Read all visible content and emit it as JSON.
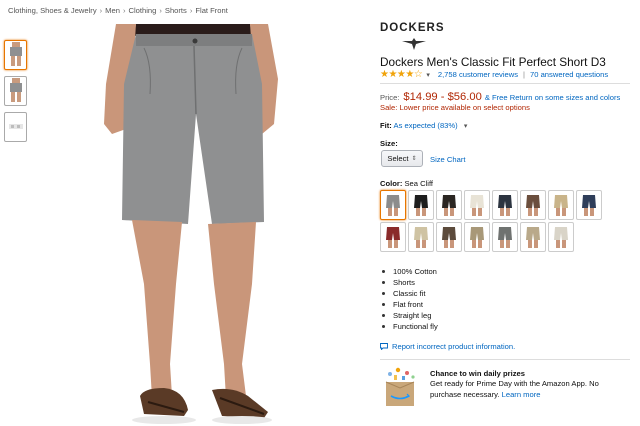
{
  "breadcrumb": [
    "Clothing, Shoes & Jewelry",
    "Men",
    "Clothing",
    "Shorts",
    "Flat Front"
  ],
  "breadcrumb_separator": "›",
  "brand": {
    "name": "DOCKERS"
  },
  "product": {
    "title": "Dockers Men's Classic Fit Perfect Short D3",
    "stars_glyph": "★★★★☆",
    "rating_caret": "▾",
    "reviews": "2,758 customer reviews",
    "divider": "|",
    "questions": "70 answered questions"
  },
  "price": {
    "label": "Price:",
    "value": "$14.99 - $56.00",
    "shipping_text": "& Free Return on some sizes and colors",
    "sale_label": "Sale:",
    "sale_text": "Lower price available on select options"
  },
  "fit": {
    "label": "Fit:",
    "value": "As expected (83%)",
    "caret": "▾"
  },
  "size": {
    "label": "Size:",
    "select_value": "Select",
    "select_arrow": "⇕",
    "chart_link": "Size Chart"
  },
  "color": {
    "label": "Color:",
    "selected": "Sea Cliff",
    "swatches": [
      "#8c8c8c",
      "#1e1e1e",
      "#2b2622",
      "#e8e3d6",
      "#2c3440",
      "#6b4e3d",
      "#c9b48a",
      "#2f3e5a",
      "#8a2a2a",
      "#cfc3a3",
      "#5c4b3c",
      "#a89878",
      "#6f7270",
      "#b9a98a",
      "#d9d4c8"
    ]
  },
  "bullets": [
    "100% Cotton",
    "Shorts",
    "Classic fit",
    "Flat front",
    "Straight leg",
    "Functional fly"
  ],
  "report": {
    "text": "Report incorrect product information."
  },
  "promo": {
    "title": "Chance to win daily prizes",
    "text": "Get ready for Prime Day with the Amazon App. No purchase necessary.",
    "link": "Learn more"
  },
  "colors": {
    "link": "#0066c0",
    "price": "#b12704",
    "star": "#f0a30a",
    "selected_border": "#e77600",
    "short_gray": "#8f9091"
  }
}
